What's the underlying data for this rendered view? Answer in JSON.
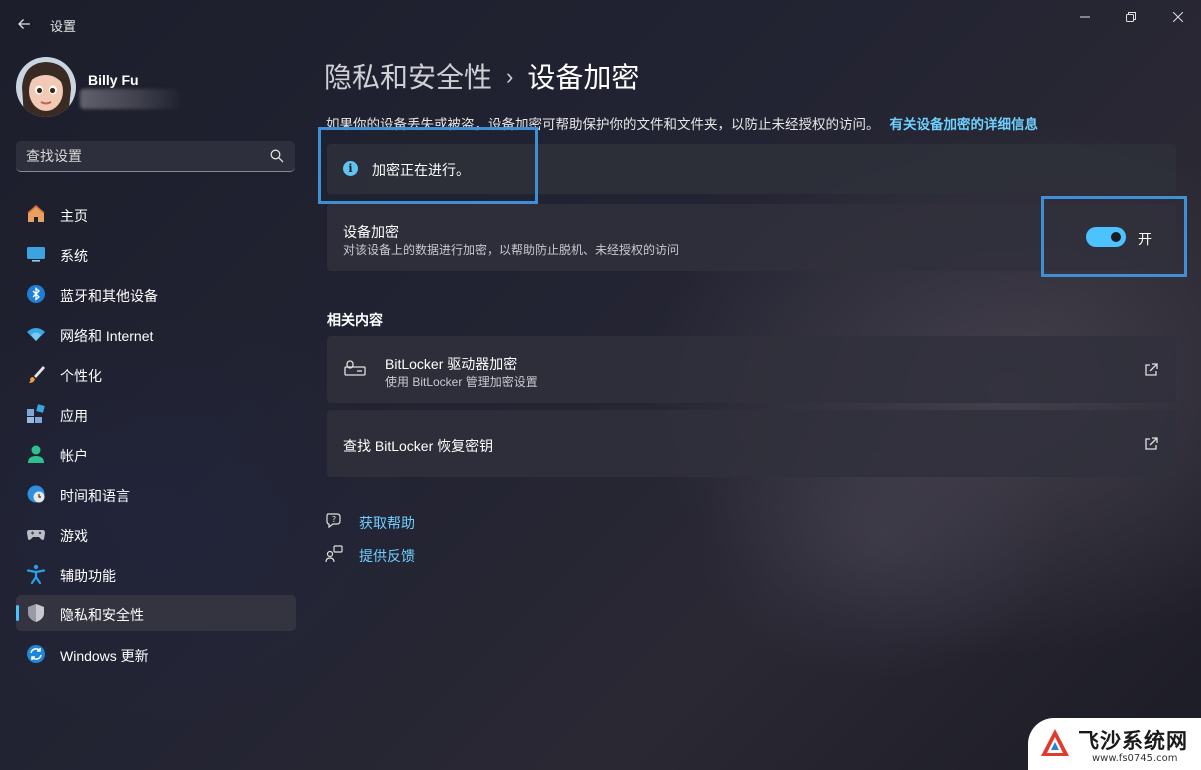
{
  "window": {
    "title": "设置"
  },
  "user": {
    "name": "Billy Fu"
  },
  "search": {
    "placeholder": "查找设置"
  },
  "sidebar": {
    "items": [
      {
        "label": "主页",
        "icon": "home-icon"
      },
      {
        "label": "系统",
        "icon": "system-icon"
      },
      {
        "label": "蓝牙和其他设备",
        "icon": "bluetooth-icon"
      },
      {
        "label": "网络和 Internet",
        "icon": "wifi-icon"
      },
      {
        "label": "个性化",
        "icon": "brush-icon"
      },
      {
        "label": "应用",
        "icon": "apps-icon"
      },
      {
        "label": "帐户",
        "icon": "account-icon"
      },
      {
        "label": "时间和语言",
        "icon": "clock-globe-icon"
      },
      {
        "label": "游戏",
        "icon": "gamepad-icon"
      },
      {
        "label": "辅助功能",
        "icon": "accessibility-icon"
      },
      {
        "label": "隐私和安全性",
        "icon": "shield-icon",
        "active": true
      },
      {
        "label": "Windows 更新",
        "icon": "update-icon"
      }
    ]
  },
  "main": {
    "breadcrumb_parent": "隐私和安全性",
    "breadcrumb_sep": "›",
    "page_title": "设备加密",
    "description": "如果你的设备丢失或被盗，设备加密可帮助保护你的文件和文件夹，以防止未经授权的访问。",
    "description_link": "有关设备加密的详细信息",
    "info_message": "加密正在进行。",
    "encryption_card": {
      "title": "设备加密",
      "subtitle": "对该设备上的数据进行加密，以帮助防止脱机、未经授权的访问",
      "toggle_state": "开",
      "toggle_on": true
    },
    "related_title": "相关内容",
    "related": [
      {
        "title": "BitLocker 驱动器加密",
        "subtitle": "使用 BitLocker 管理加密设置",
        "icon": "bitlocker-drive-icon"
      },
      {
        "title": "查找 BitLocker 恢复密钥"
      }
    ],
    "help_links": [
      {
        "label": "获取帮助",
        "icon": "help-chat-icon"
      },
      {
        "label": "提供反馈",
        "icon": "feedback-icon"
      }
    ]
  },
  "watermark": {
    "brand": "飞沙系统网",
    "url": "www.fs0745.com"
  },
  "colors": {
    "accent": "#4cc2ff",
    "link": "#6fd0ff",
    "highlight_box": "#3f8fd6"
  }
}
